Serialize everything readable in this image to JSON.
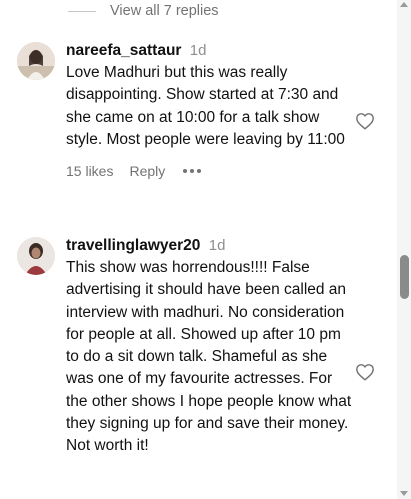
{
  "view_replies": {
    "label": "View all 7 replies"
  },
  "comments": [
    {
      "username": "nareefa_sattaur",
      "timestamp": "1d",
      "text": "Love Madhuri but this was really disappointing. Show started at 7:30 and she came on at 10:00 for a talk show style. Most people were leaving by 11:00",
      "likes": "15 likes",
      "reply_label": "Reply",
      "avatar_icon": "avatar-photo"
    },
    {
      "username": "travellinglawyer20",
      "timestamp": "1d",
      "text": "This show was horrendous!!!! False advertising it should have been called an interview with madhuri. No consideration for people at all. Showed up after 10 pm to do a sit down talk. Shameful as she was one of my favourite actresses. For the other shows I hope people know what they signing up for and save their money. Not worth it!",
      "avatar_icon": "avatar-photo"
    }
  ],
  "colors": {
    "text": "#111111",
    "muted": "#737373",
    "timestamp": "#8e8e8e",
    "background": "#ffffff"
  }
}
